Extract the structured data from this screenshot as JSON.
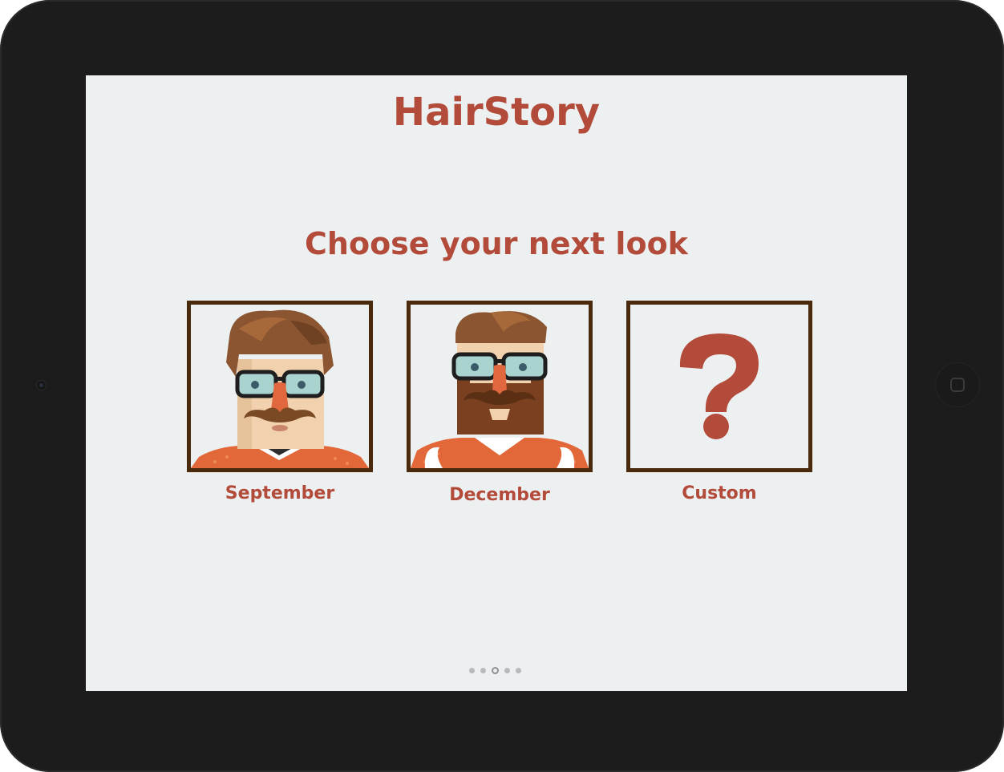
{
  "app": {
    "title": "HairStory"
  },
  "screen": {
    "prompt": "Choose your next look"
  },
  "options": [
    {
      "label": "September",
      "icon": "hipster-avatar-short-beard-icon"
    },
    {
      "label": "December",
      "icon": "hipster-avatar-full-beard-icon"
    },
    {
      "label": "Custom",
      "icon": "question-mark-icon"
    }
  ],
  "pager": {
    "total": 5,
    "current": 3
  },
  "colors": {
    "accent": "#b34b3b",
    "frame": "#4a2a0c",
    "background": "#edf0f1",
    "device": "#1c1c1c"
  }
}
